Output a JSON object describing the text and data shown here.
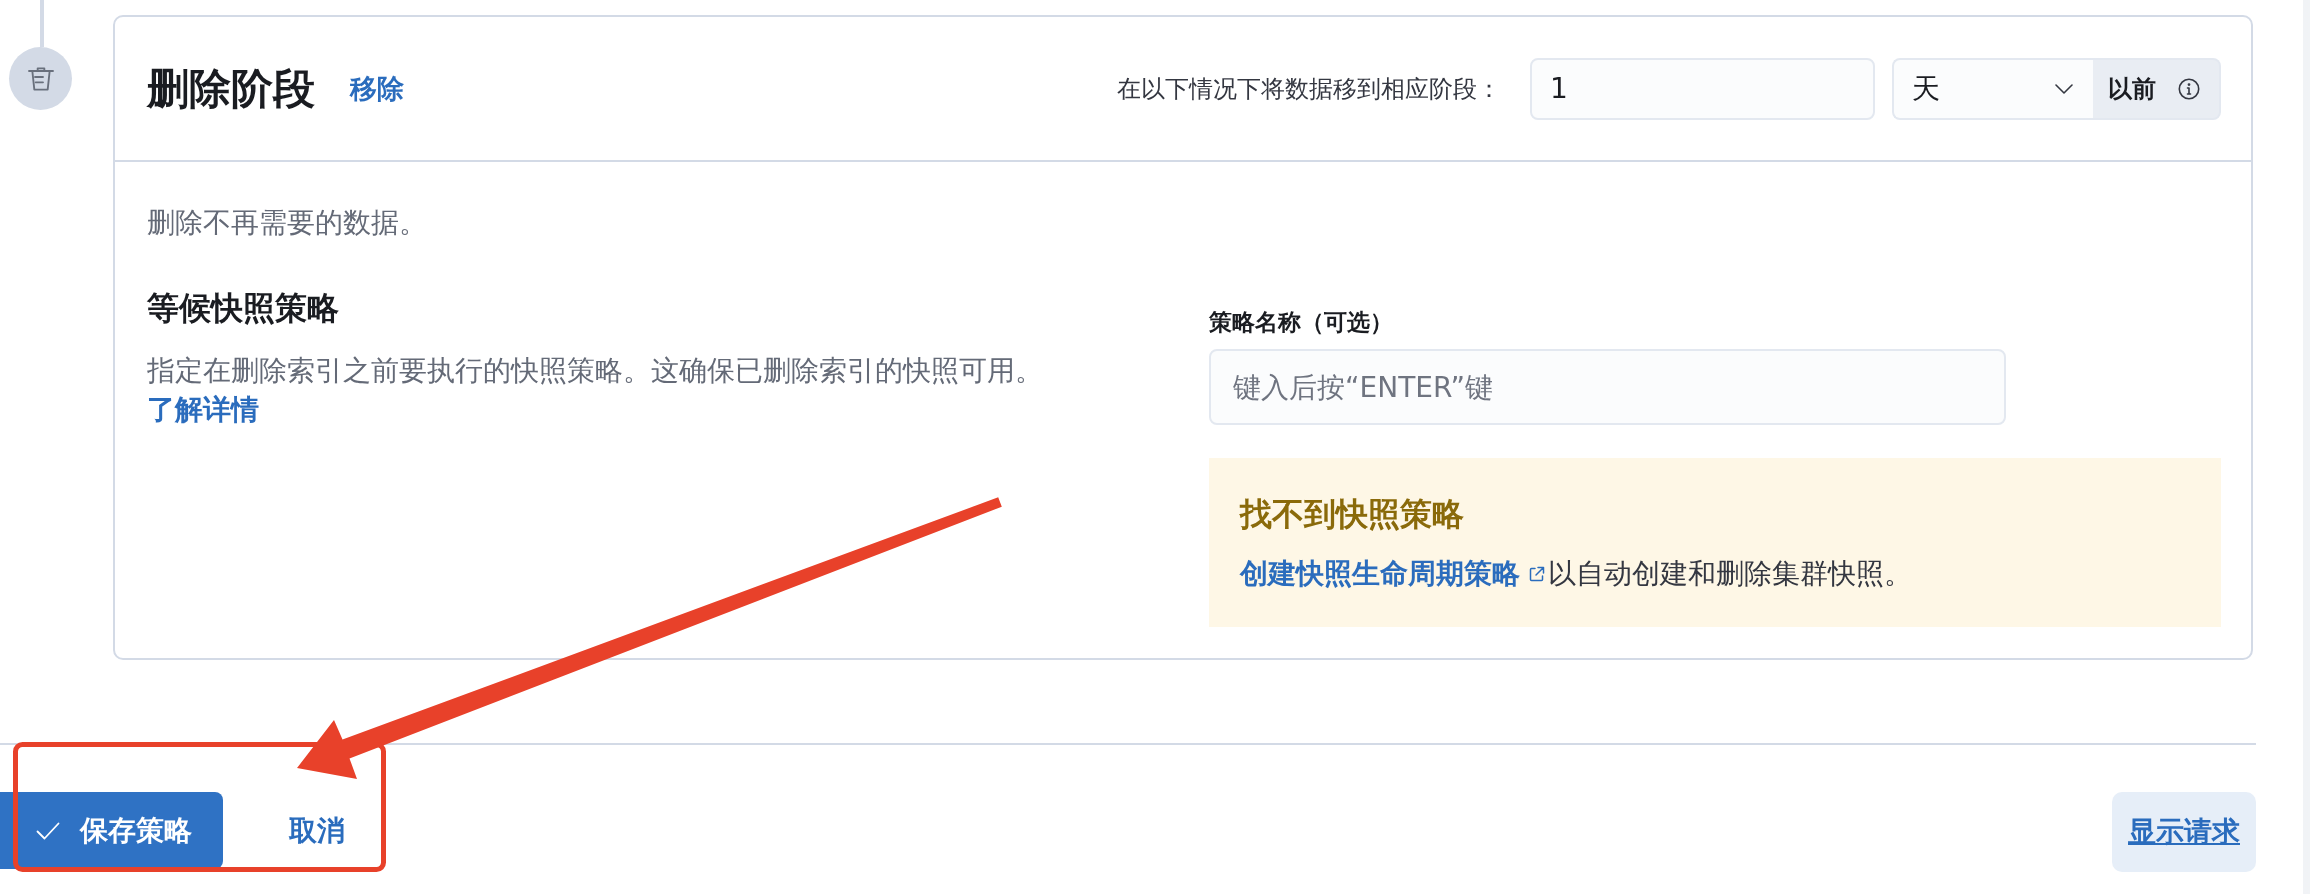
{
  "phase_header": {
    "title": "删除阶段",
    "remove_link": "移除",
    "timing_label": "在以下情况下将数据移到相应阶段：",
    "age_input": {
      "value": "1"
    },
    "unit_select": {
      "value": "天"
    },
    "unit_suffix": "以前"
  },
  "description": "删除不再需要的数据。",
  "wait_for_snapshot": {
    "title": "等候快照策略",
    "text": "指定在删除索引之前要执行的快照策略。这确保已删除索引的快照可用。",
    "link": "了解详情"
  },
  "policy_name_field": {
    "label": "策略名称（可选）",
    "placeholder": "键入后按“ENTER”键"
  },
  "callout": {
    "title": "找不到快照策略",
    "link": "创建快照生命周期策略",
    "text": "以自动创建和删除集群快照。"
  },
  "footer": {
    "save_button": "保存策略",
    "cancel_button": "取消",
    "show_request_button": "显示请求"
  },
  "markup": {
    "arrow": true,
    "highlight_frame": true
  }
}
